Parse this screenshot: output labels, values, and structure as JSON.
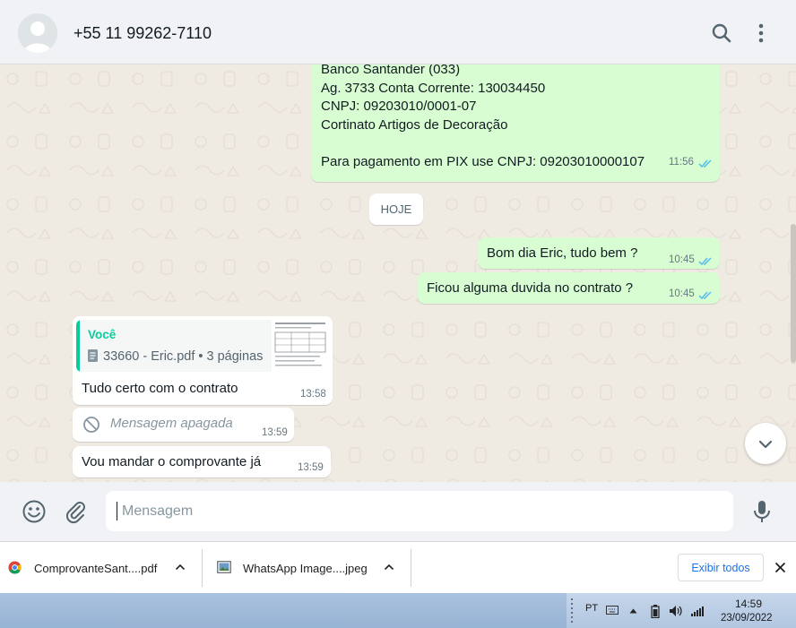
{
  "header": {
    "contact_name": "+55 11 99262-7110",
    "icons": [
      "avatar-placeholder-icon",
      "search-icon",
      "kebab-menu-icon"
    ]
  },
  "messages": {
    "bank_details": {
      "lines": [
        "Banco Santander (033)",
        "Ag. 3733 Conta Corrente: 130034450",
        "CNPJ: 09203010/0001-07",
        "Cortinato Artigos de Decoração",
        "",
        "Para pagamento em PIX use CNPJ: 09203010000107"
      ],
      "time": "11:56",
      "status": "read"
    },
    "day_chip": "HOJE",
    "greeting": {
      "text": "Bom dia Eric, tudo bem ?",
      "time": "10:45",
      "status": "read"
    },
    "question": {
      "text": "Ficou alguma duvida no contrato ?",
      "time": "10:45",
      "status": "read"
    },
    "reply": {
      "quote_author": "Você",
      "quote_file": "33660 - Eric.pdf • 3 páginas",
      "text": "Tudo certo com o contrato",
      "time": "13:58"
    },
    "deleted": {
      "text": "Mensagem apagada",
      "time": "13:59"
    },
    "receipt": {
      "text": "Vou mandar o comprovante já",
      "time": "13:59"
    }
  },
  "composer": {
    "placeholder": "Mensagem",
    "icons": [
      "emoji-icon",
      "attach-icon",
      "microphone-icon"
    ]
  },
  "downloads": {
    "items": [
      {
        "name": "ComprovanteSant....pdf",
        "icon": "chrome-icon"
      },
      {
        "name": "WhatsApp Image....jpeg",
        "icon": "image-file-icon"
      }
    ],
    "show_all_label": "Exibir todos"
  },
  "taskbar": {
    "language": "PT",
    "time": "14:59",
    "date": "23/09/2022"
  },
  "colors": {
    "outgoing_bubble": "#d9fdd3",
    "incoming_bubble": "#ffffff",
    "chat_background": "#efeae2",
    "accent": "#06cf9c",
    "read_ticks": "#53bdeb"
  }
}
